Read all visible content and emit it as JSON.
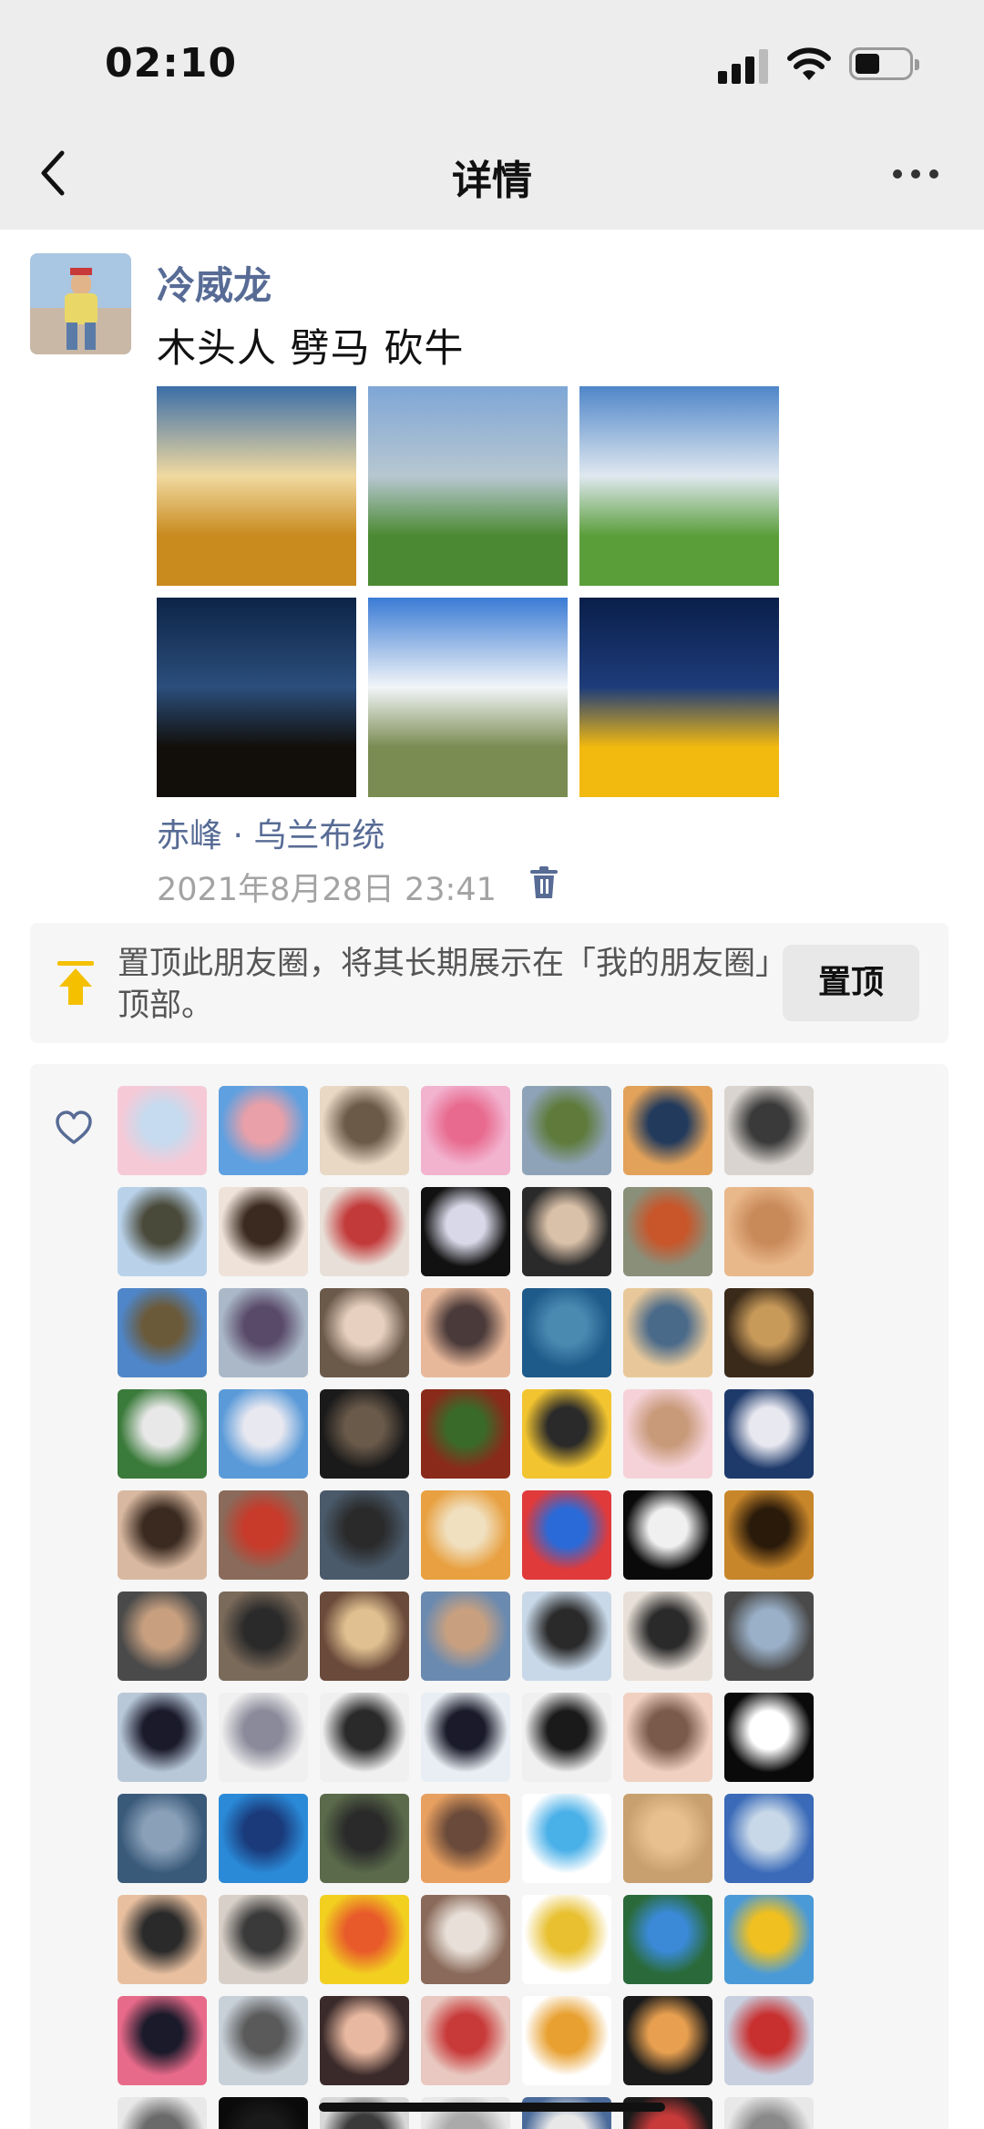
{
  "status_bar": {
    "time": "02:10"
  },
  "nav": {
    "title": "详情"
  },
  "post": {
    "author": "冷威龙",
    "text": "木头人  劈马 砍牛",
    "location": "赤峰 · 乌兰布统",
    "timestamp": "2021年8月28日 23:41",
    "photos": [
      {
        "name": "sunset-field",
        "top": "#3b6ea8",
        "mid": "#f0d9a0",
        "bottom": "#c98a1e"
      },
      {
        "name": "cow-lake",
        "top": "#7ea6d6",
        "mid": "#b7c7d1",
        "bottom": "#4b8a32"
      },
      {
        "name": "grassland-horse",
        "top": "#4f86c9",
        "mid": "#dfe8ef",
        "bottom": "#5a9e3a"
      },
      {
        "name": "silhouette-sunset",
        "top": "#0d2447",
        "mid": "#2b4e7c",
        "bottom": "#120f0a"
      },
      {
        "name": "person-sky",
        "top": "#3a7bd5",
        "mid": "#f2f5f8",
        "bottom": "#7a8c52"
      },
      {
        "name": "car-stars",
        "top": "#0a1f4a",
        "mid": "#1e3c7a",
        "bottom": "#f2b90f"
      }
    ]
  },
  "pin": {
    "text": "置顶此朋友圈，将其长期展示在「我的朋友圈」顶部。",
    "button": "置顶"
  },
  "likes": {
    "avatars": [
      [
        "#f6c9d6",
        "#c6dbef"
      ],
      [
        "#5ea0e0",
        "#e9a0a8"
      ],
      [
        "#e8d8c4",
        "#6b5a48"
      ],
      [
        "#f2b3cf",
        "#e86a8f"
      ],
      [
        "#8ea3b8",
        "#5f7a3a"
      ],
      [
        "#e2a25a",
        "#223a5c"
      ],
      [
        "#d9d4cf",
        "#3a3a3a"
      ],
      [
        "#b9d2ea",
        "#4a4a3a"
      ],
      [
        "#efe2d8",
        "#3a2a20"
      ],
      [
        "#e8e0d8",
        "#c23a3a"
      ],
      [
        "#111111",
        "#d8d8e8"
      ],
      [
        "#2a2a2a",
        "#d9c0a8"
      ],
      [
        "#8a8f7a",
        "#c8562a"
      ],
      [
        "#e9b88a",
        "#c98a5a"
      ],
      [
        "#4f86c9",
        "#6b5a3a"
      ],
      [
        "#aab8c8",
        "#5a4a6a"
      ],
      [
        "#6b5a4a",
        "#e8d0c0"
      ],
      [
        "#e8b89a",
        "#4a3a3a"
      ],
      [
        "#1e5a8a",
        "#4a8ab0"
      ],
      [
        "#e8c89a",
        "#4a6a8a"
      ],
      [
        "#3a2a1a",
        "#c89a5a"
      ],
      [
        "#3a7a3a",
        "#e8e8e8"
      ],
      [
        "#5a9ad8",
        "#e8e8f0"
      ],
      [
        "#1a1a1a",
        "#6a5a4a"
      ],
      [
        "#8a2a1a",
        "#3a6a2a"
      ],
      [
        "#f2c430",
        "#2a2a2a"
      ],
      [
        "#f5d2d8",
        "#c89a7a"
      ],
      [
        "#1e3a6a",
        "#e8e8f0"
      ],
      [
        "#d8b8a0",
        "#3a2a20"
      ],
      [
        "#8a6a5a",
        "#c83a2a"
      ],
      [
        "#4a5a6a",
        "#2a2a2a"
      ],
      [
        "#e8a040",
        "#f0e0c0"
      ],
      [
        "#e03a3a",
        "#2a6ad8"
      ],
      [
        "#0a0a0a",
        "#f0f0f0"
      ],
      [
        "#c8862a",
        "#2a1a0a"
      ],
      [
        "#4a4a4a",
        "#c8a080"
      ],
      [
        "#7a6a5a",
        "#2a2a2a"
      ],
      [
        "#6a4a3a",
        "#e0c090"
      ],
      [
        "#6a8ab0",
        "#c8a080"
      ],
      [
        "#c8d8e8",
        "#2a2a2a"
      ],
      [
        "#e8e0d8",
        "#2a2a2a"
      ],
      [
        "#4a4a4a",
        "#9ab0c8"
      ],
      [
        "#b8c8d8",
        "#1a1a2a"
      ],
      [
        "#f0f0f0",
        "#8a8a9a"
      ],
      [
        "#f0f0f0",
        "#2a2a2a"
      ],
      [
        "#e8eef4",
        "#1a1a2a"
      ],
      [
        "#f0f0f0",
        "#1a1a1a"
      ],
      [
        "#f0d0c0",
        "#7a5a4a"
      ],
      [
        "#0a0a0a",
        "#ffffff"
      ],
      [
        "#3a5a7a",
        "#8aa0b8"
      ],
      [
        "#2a8ad8",
        "#1a3a7a"
      ],
      [
        "#5a6a4a",
        "#2a2a2a"
      ],
      [
        "#e8a060",
        "#6a4a3a"
      ],
      [
        "#ffffff",
        "#4ab0e8"
      ],
      [
        "#c8a070",
        "#e8c090"
      ],
      [
        "#3a6ab8",
        "#c8d8e8"
      ],
      [
        "#e8c0a0",
        "#2a2a2a"
      ],
      [
        "#d8d0c8",
        "#3a3a3a"
      ],
      [
        "#f2d020",
        "#e85a2a"
      ],
      [
        "#8a6a5a",
        "#e8e0d8"
      ],
      [
        "#ffffff",
        "#e8c030"
      ],
      [
        "#2a6a3a",
        "#3a8ad8"
      ],
      [
        "#4a9ad8",
        "#f0c020"
      ],
      [
        "#e86a8a",
        "#1a1a2a"
      ],
      [
        "#c8d0d8",
        "#5a5a5a"
      ],
      [
        "#3a2a2a",
        "#e8b8a0"
      ],
      [
        "#e8c8c0",
        "#c83a3a"
      ],
      [
        "#ffffff",
        "#e8a030"
      ],
      [
        "#1a1a1a",
        "#e8a050"
      ],
      [
        "#c8d0e0",
        "#c83030"
      ],
      [
        "#e8e8e8",
        "#6a6a6a"
      ],
      [
        "#0a0a0a",
        "#1a1a1a"
      ],
      [
        "#d8d8d8",
        "#3a3a3a"
      ],
      [
        "#e8e8e8",
        "#aaaaaa"
      ],
      [
        "#4a6a9a",
        "#e8e8e8"
      ],
      [
        "#1a1a1a",
        "#c83a3a"
      ],
      [
        "#e8e8e8",
        "#8a8a8a"
      ]
    ]
  }
}
